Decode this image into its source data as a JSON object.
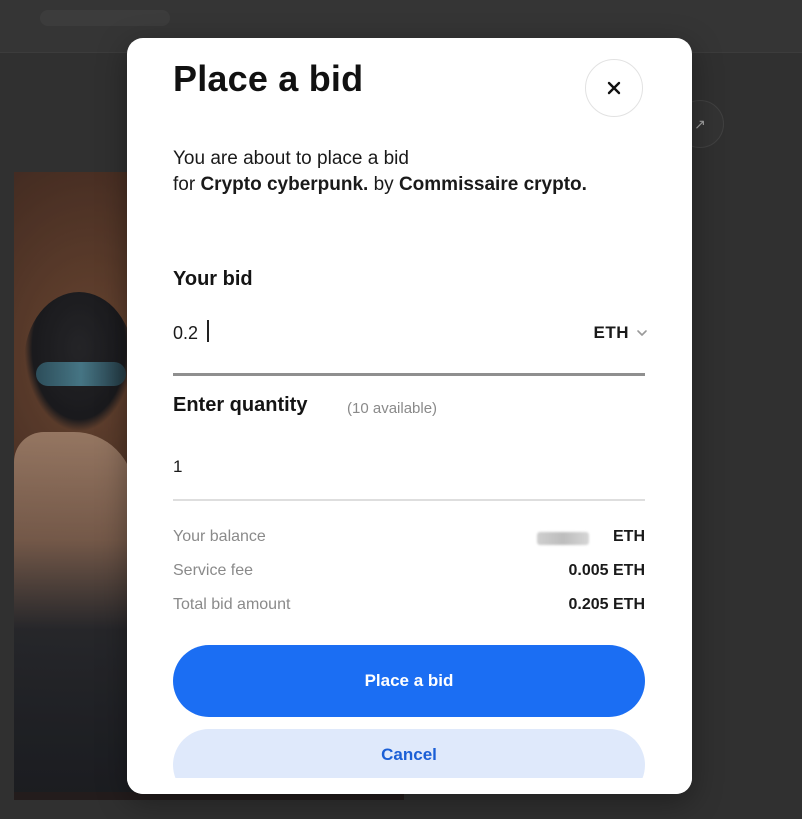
{
  "background": {
    "side_button_icon": "arrow-up-right-icon",
    "side_button_glyph": "↗"
  },
  "modal": {
    "title": "Place a bid",
    "close_icon": "close-icon",
    "description": {
      "line1": "You are about to place a bid",
      "for_prefix": "for ",
      "item_name": "Crypto cyberpunk.",
      "by_text": " by ",
      "creator_name": "Commissaire crypto."
    },
    "bid": {
      "label": "Your bid",
      "value": "0.2",
      "currency": "ETH",
      "currency_icon": "chevron-down-icon"
    },
    "quantity": {
      "label": "Enter quantity",
      "available": "(10 available)",
      "value": "1"
    },
    "summary": {
      "balance_label": "Your balance",
      "balance_value": "ETH",
      "fee_label": "Service fee",
      "fee_value": "0.005 ETH",
      "total_label": "Total bid amount",
      "total_value": "0.205 ETH"
    },
    "primary_button": "Place a bid",
    "secondary_button": "Cancel"
  },
  "colors": {
    "primary": "#1b6ef3",
    "secondary_bg": "#dfe9fb",
    "secondary_text": "#1b5fd6",
    "backdrop": "#3a3a3a"
  }
}
